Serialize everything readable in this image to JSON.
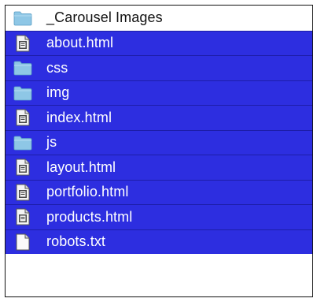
{
  "file_browser": {
    "items": [
      {
        "name": "_Carousel Images",
        "type": "folder",
        "selected": false,
        "icon": "folder-icon"
      },
      {
        "name": "about.html",
        "type": "html",
        "selected": true,
        "icon": "html-file-icon"
      },
      {
        "name": "css",
        "type": "folder",
        "selected": true,
        "icon": "folder-icon"
      },
      {
        "name": "img",
        "type": "folder",
        "selected": true,
        "icon": "folder-icon"
      },
      {
        "name": "index.html",
        "type": "html",
        "selected": true,
        "icon": "html-file-icon"
      },
      {
        "name": "js",
        "type": "folder",
        "selected": true,
        "icon": "folder-icon"
      },
      {
        "name": "layout.html",
        "type": "html",
        "selected": true,
        "icon": "html-file-icon"
      },
      {
        "name": "portfolio.html",
        "type": "html",
        "selected": true,
        "icon": "html-file-icon"
      },
      {
        "name": "products.html",
        "type": "html",
        "selected": true,
        "icon": "html-file-icon"
      },
      {
        "name": "robots.txt",
        "type": "text",
        "selected": true,
        "icon": "text-file-icon"
      }
    ]
  },
  "colors": {
    "selection": "#2d2ee0",
    "folder": "#8ec7e6",
    "border": "#111111"
  }
}
